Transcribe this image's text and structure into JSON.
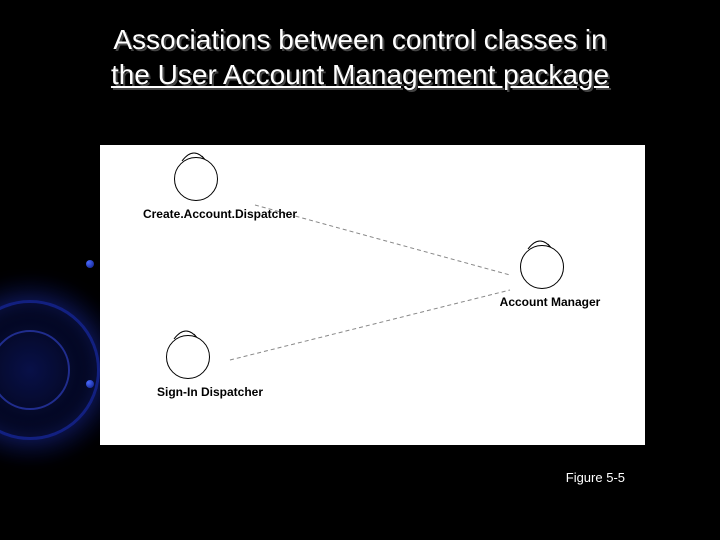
{
  "slide": {
    "title_line1": "Associations between control classes in",
    "title_line2": "the User Account Management package",
    "caption": "Figure 5-5"
  },
  "diagram": {
    "classes": [
      {
        "id": "create-account-dispatcher",
        "label": "Create.Account.Dispatcher"
      },
      {
        "id": "sign-in-dispatcher",
        "label": "Sign-In Dispatcher"
      },
      {
        "id": "account-manager",
        "label": "Account Manager"
      }
    ],
    "associations": [
      {
        "from": "create-account-dispatcher",
        "to": "account-manager"
      },
      {
        "from": "sign-in-dispatcher",
        "to": "account-manager"
      }
    ]
  }
}
